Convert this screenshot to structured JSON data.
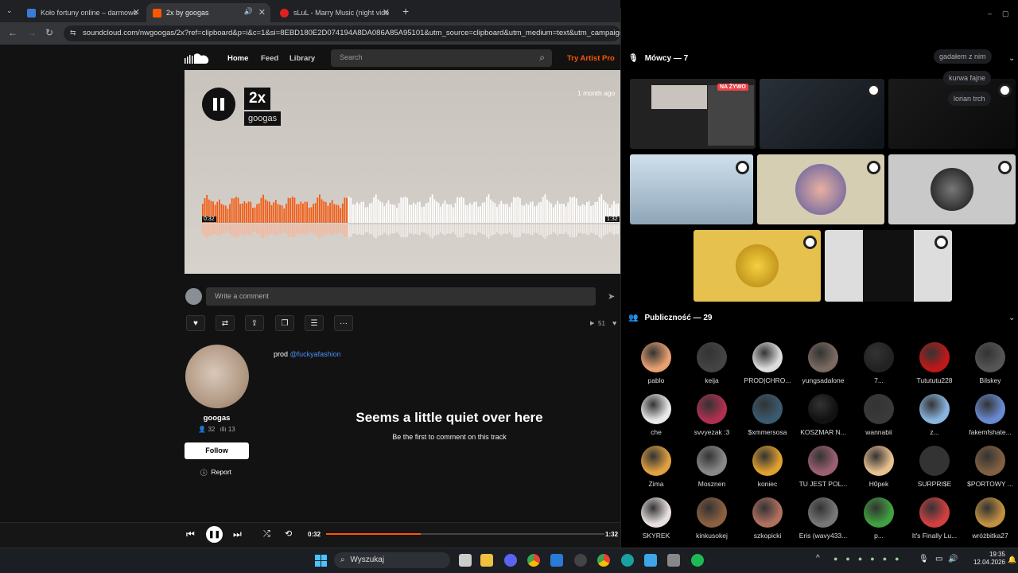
{
  "browser": {
    "tabs": [
      {
        "title": "Koło fortuny online – darmowe",
        "favicon_color": "#3a7bd5"
      },
      {
        "title": "2x by googas",
        "favicon_color": "#f50"
      },
      {
        "title": "sLuL - Marry Music (night vide",
        "favicon_color": "#e02020"
      }
    ],
    "url": "soundcloud.com/nwgoogas/2x?ref=clipboard&p=i&c=1&si=8EBD180E2D074194A8DA086A85A95101&utm_source=clipboard&utm_medium=text&utm_campaign"
  },
  "soundcloud": {
    "nav": {
      "home": "Home",
      "feed": "Feed",
      "library": "Library",
      "search_placeholder": "Search",
      "try_pro": "Try Artist Pro"
    },
    "track": {
      "title": "2x",
      "artist": "googas",
      "posted": "1 month ago",
      "time_start": "0:32",
      "time_end": "1:32",
      "played_fraction": 0.35
    },
    "comment_placeholder": "Write a comment",
    "plays": "51",
    "uploader": {
      "name": "googas",
      "followers": "32",
      "tracks": "13",
      "follow_label": "Follow",
      "report_label": "Report"
    },
    "description_prefix": "prod ",
    "description_link": "@fuckyafashion",
    "empty_title": "Seems a little quiet over here",
    "empty_sub": "Be the first to comment on this track",
    "player": {
      "elapsed": "0:32",
      "duration": "1:32",
      "progress_fraction": 0.34
    }
  },
  "discord": {
    "speakers_label": "Mówcy — 7",
    "live_badge": "NA ŻYWO",
    "chat_bubbles": [
      "gadałem z nim",
      "kurwa fajne",
      "lorian trch"
    ],
    "audience_label": "Publiczność — 29",
    "audience": [
      {
        "name": "pablo",
        "color": "#e8a070"
      },
      {
        "name": "keija",
        "color": "#444"
      },
      {
        "name": "PROD|CHRO...",
        "color": "#ddd"
      },
      {
        "name": "yungsadalone",
        "color": "#7a6a60"
      },
      {
        "name": "7...",
        "color": "#222"
      },
      {
        "name": "Tutututu228",
        "color": "#c01818"
      },
      {
        "name": "Bilskey",
        "color": "#555"
      },
      {
        "name": "che",
        "color": "#e8e8e8"
      },
      {
        "name": "svvyezak :3",
        "color": "#b03050"
      },
      {
        "name": "$xmmersosa",
        "color": "#3a5a70"
      },
      {
        "name": "KOSZMAR N...",
        "color": "#111"
      },
      {
        "name": "wannabii",
        "color": "#3a3a3a"
      },
      {
        "name": "z...",
        "color": "#8ab4e0"
      },
      {
        "name": "fakemfshate...",
        "color": "#6a8ad0"
      },
      {
        "name": "Zima",
        "color": "#e0a040"
      },
      {
        "name": "Mosznen",
        "color": "#888"
      },
      {
        "name": "koniec",
        "color": "#e0a030"
      },
      {
        "name": "TU JEST POL...",
        "color": "#9a6070"
      },
      {
        "name": "H0pek",
        "color": "#e8c090"
      },
      {
        "name": "SURPRI$E",
        "color": "#333"
      },
      {
        "name": "$PORTOWY ...",
        "color": "#806040"
      },
      {
        "name": "SKYREK",
        "color": "#e8e0e0"
      },
      {
        "name": "kinkusokej",
        "color": "#8a6040"
      },
      {
        "name": "szkopicki",
        "color": "#b07060"
      },
      {
        "name": "Eris (wavy433...",
        "color": "#777"
      },
      {
        "name": "p...",
        "color": "#40a040"
      },
      {
        "name": "It's Finally Lu...",
        "color": "#d04040"
      },
      {
        "name": "wróżbitka27",
        "color": "#c09040"
      }
    ]
  },
  "taskbar": {
    "search": "Wyszukaj",
    "time": "19:35",
    "date": "12.04.2026"
  }
}
